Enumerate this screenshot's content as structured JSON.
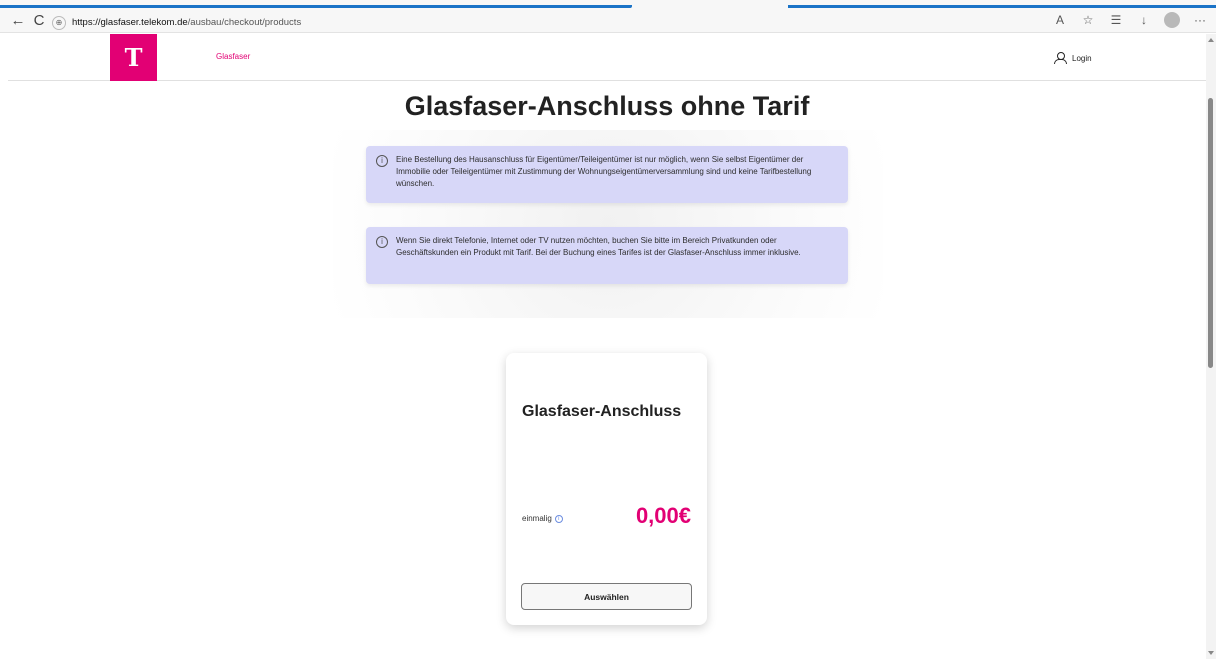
{
  "browser": {
    "url_host": "https://glasfaser.telekom.de",
    "url_path": "/ausbau/checkout/products",
    "back": "←",
    "reload": "C",
    "lock": "⊕",
    "read_aloud": "A",
    "favorite": "☆",
    "collections": "☰",
    "downloads": "↓",
    "more": "···"
  },
  "header": {
    "logo": "T",
    "nav_label": "Glasfaser",
    "login_label": "Login"
  },
  "main": {
    "title": "Glasfaser-Anschluss ohne Tarif",
    "info_icon": "i",
    "info1": "Eine Bestellung des Hausanschluss für Eigentümer/Teileigentümer ist nur möglich, wenn Sie selbst Eigentümer der Immobilie oder Teileigentümer mit Zustimmung der Wohnungseigentümerversammlung sind und keine Tarifbestellung wünschen.",
    "info2": "Wenn Sie direkt Telefonie, Internet oder TV nutzen möchten, buchen Sie bitte im Bereich Privatkunden oder Geschäftskunden ein Produkt mit Tarif. Bei der Buchung eines Tarifes ist der Glasfaser-Anschluss immer inklusive."
  },
  "product": {
    "title": "Glasfaser-Anschluss",
    "price_label": "einmalig",
    "price_info_icon": "i",
    "price": "0,00€",
    "button": "Auswählen"
  },
  "colors": {
    "brand": "#e20074",
    "info_box": "#d7d7f8"
  }
}
